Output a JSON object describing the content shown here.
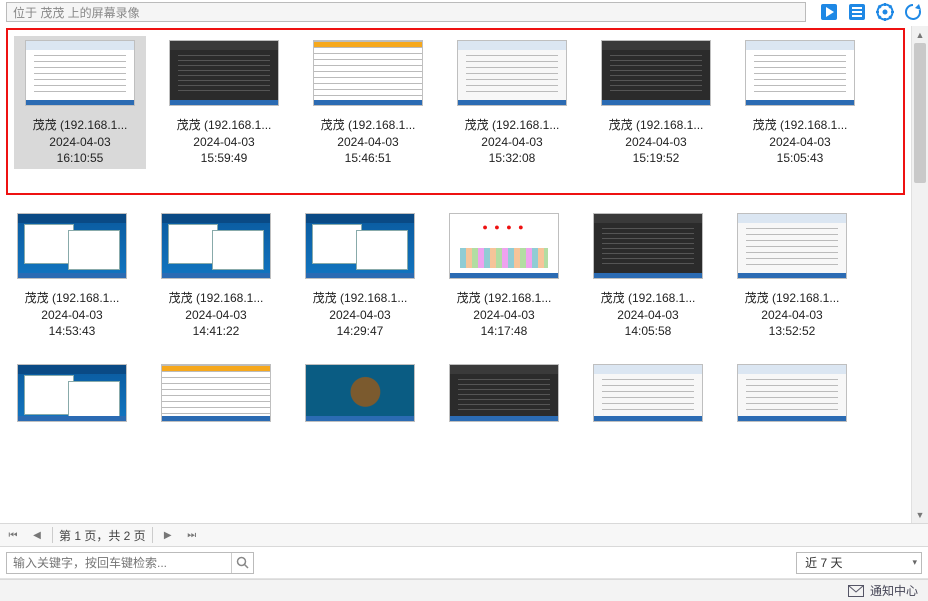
{
  "header": {
    "title": "位于 茂茂 上的屏幕录像"
  },
  "topIcons": [
    "play-icon",
    "list-icon",
    "gear-icon",
    "refresh-icon"
  ],
  "rows": [
    {
      "highlighted": true,
      "items": [
        {
          "name": "茂茂 (192.168.1...",
          "date": "2024-04-03",
          "time": "16:10:55",
          "kind": "doc",
          "selected": true
        },
        {
          "name": "茂茂 (192.168.1...",
          "date": "2024-04-03",
          "time": "15:59:49",
          "kind": "dark"
        },
        {
          "name": "茂茂 (192.168.1...",
          "date": "2024-04-03",
          "time": "15:46:51",
          "kind": "orange"
        },
        {
          "name": "茂茂 (192.168.1...",
          "date": "2024-04-03",
          "time": "15:32:08",
          "kind": "light"
        },
        {
          "name": "茂茂 (192.168.1...",
          "date": "2024-04-03",
          "time": "15:19:52",
          "kind": "dark"
        },
        {
          "name": "茂茂 (192.168.1...",
          "date": "2024-04-03",
          "time": "15:05:43",
          "kind": "doc"
        }
      ]
    },
    {
      "highlighted": false,
      "items": [
        {
          "name": "茂茂 (192.168.1...",
          "date": "2024-04-03",
          "time": "14:53:43",
          "kind": "desk"
        },
        {
          "name": "茂茂 (192.168.1...",
          "date": "2024-04-03",
          "time": "14:41:22",
          "kind": "desk"
        },
        {
          "name": "茂茂 (192.168.1...",
          "date": "2024-04-03",
          "time": "14:29:47",
          "kind": "desk"
        },
        {
          "name": "茂茂 (192.168.1...",
          "date": "2024-04-03",
          "time": "14:17:48",
          "kind": "colorful"
        },
        {
          "name": "茂茂 (192.168.1...",
          "date": "2024-04-03",
          "time": "14:05:58",
          "kind": "dark"
        },
        {
          "name": "茂茂 (192.168.1...",
          "date": "2024-04-03",
          "time": "13:52:52",
          "kind": "light"
        }
      ]
    },
    {
      "highlighted": false,
      "partial": true,
      "items": [
        {
          "kind": "desk"
        },
        {
          "kind": "orange"
        },
        {
          "kind": "turtle"
        },
        {
          "kind": "dark"
        },
        {
          "kind": "light"
        },
        {
          "kind": "light"
        }
      ]
    }
  ],
  "pager": {
    "label": "第 1 页，共 2 页"
  },
  "filter": {
    "search_placeholder": "输入关键字，按回车键检索...",
    "range_label": "近 7 天"
  },
  "status": {
    "label": "通知中心"
  }
}
